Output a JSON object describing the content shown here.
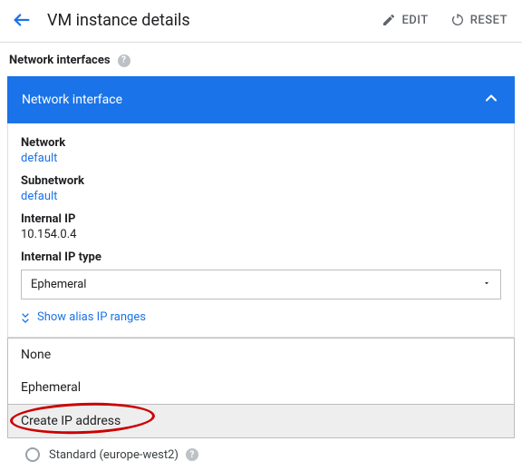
{
  "header": {
    "title": "VM instance details",
    "edit_label": "EDIT",
    "reset_label": "RESET"
  },
  "section": {
    "network_interfaces_label": "Network interfaces"
  },
  "panel": {
    "title": "Network interface",
    "fields": {
      "network_label": "Network",
      "network_value": "default",
      "subnetwork_label": "Subnetwork",
      "subnetwork_value": "default",
      "internal_ip_label": "Internal IP",
      "internal_ip_value": "10.154.0.4",
      "internal_ip_type_label": "Internal IP type",
      "internal_ip_type_value": "Ephemeral"
    },
    "show_alias_label": "Show alias IP ranges"
  },
  "dropdown": {
    "options": [
      "None",
      "Ephemeral",
      "Create IP address"
    ]
  },
  "radio": {
    "standard_label": "Standard (europe-west2)"
  }
}
